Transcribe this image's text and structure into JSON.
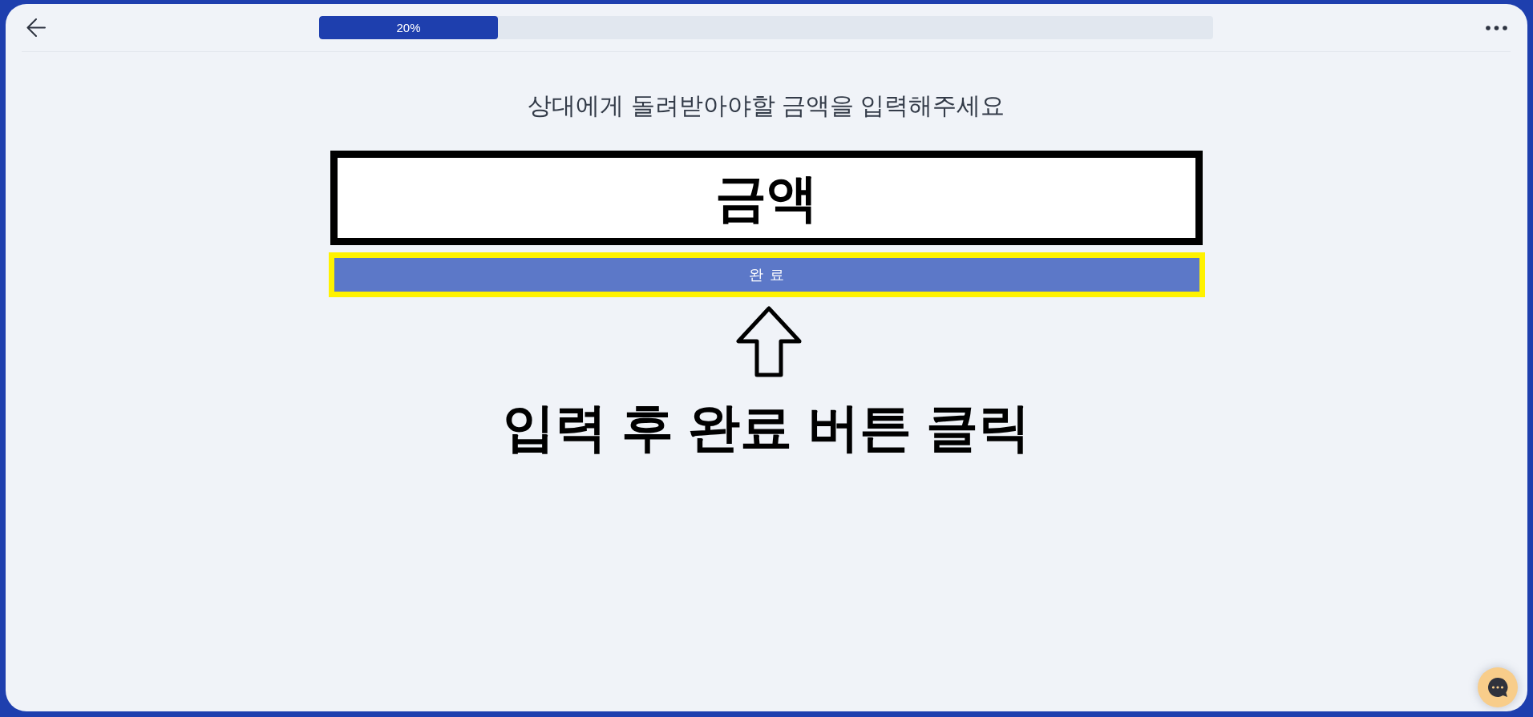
{
  "header": {
    "progress": {
      "level": 0.2,
      "reading": "20%"
    }
  },
  "prompt": "상대에게 돌려받아야할 금액을 입력해주세요",
  "amount_field": {
    "annotation": "금액"
  },
  "submit_button": {
    "label": "완료",
    "highlighted": true
  },
  "instruction": "입력 후 완료 버튼 클릭"
}
